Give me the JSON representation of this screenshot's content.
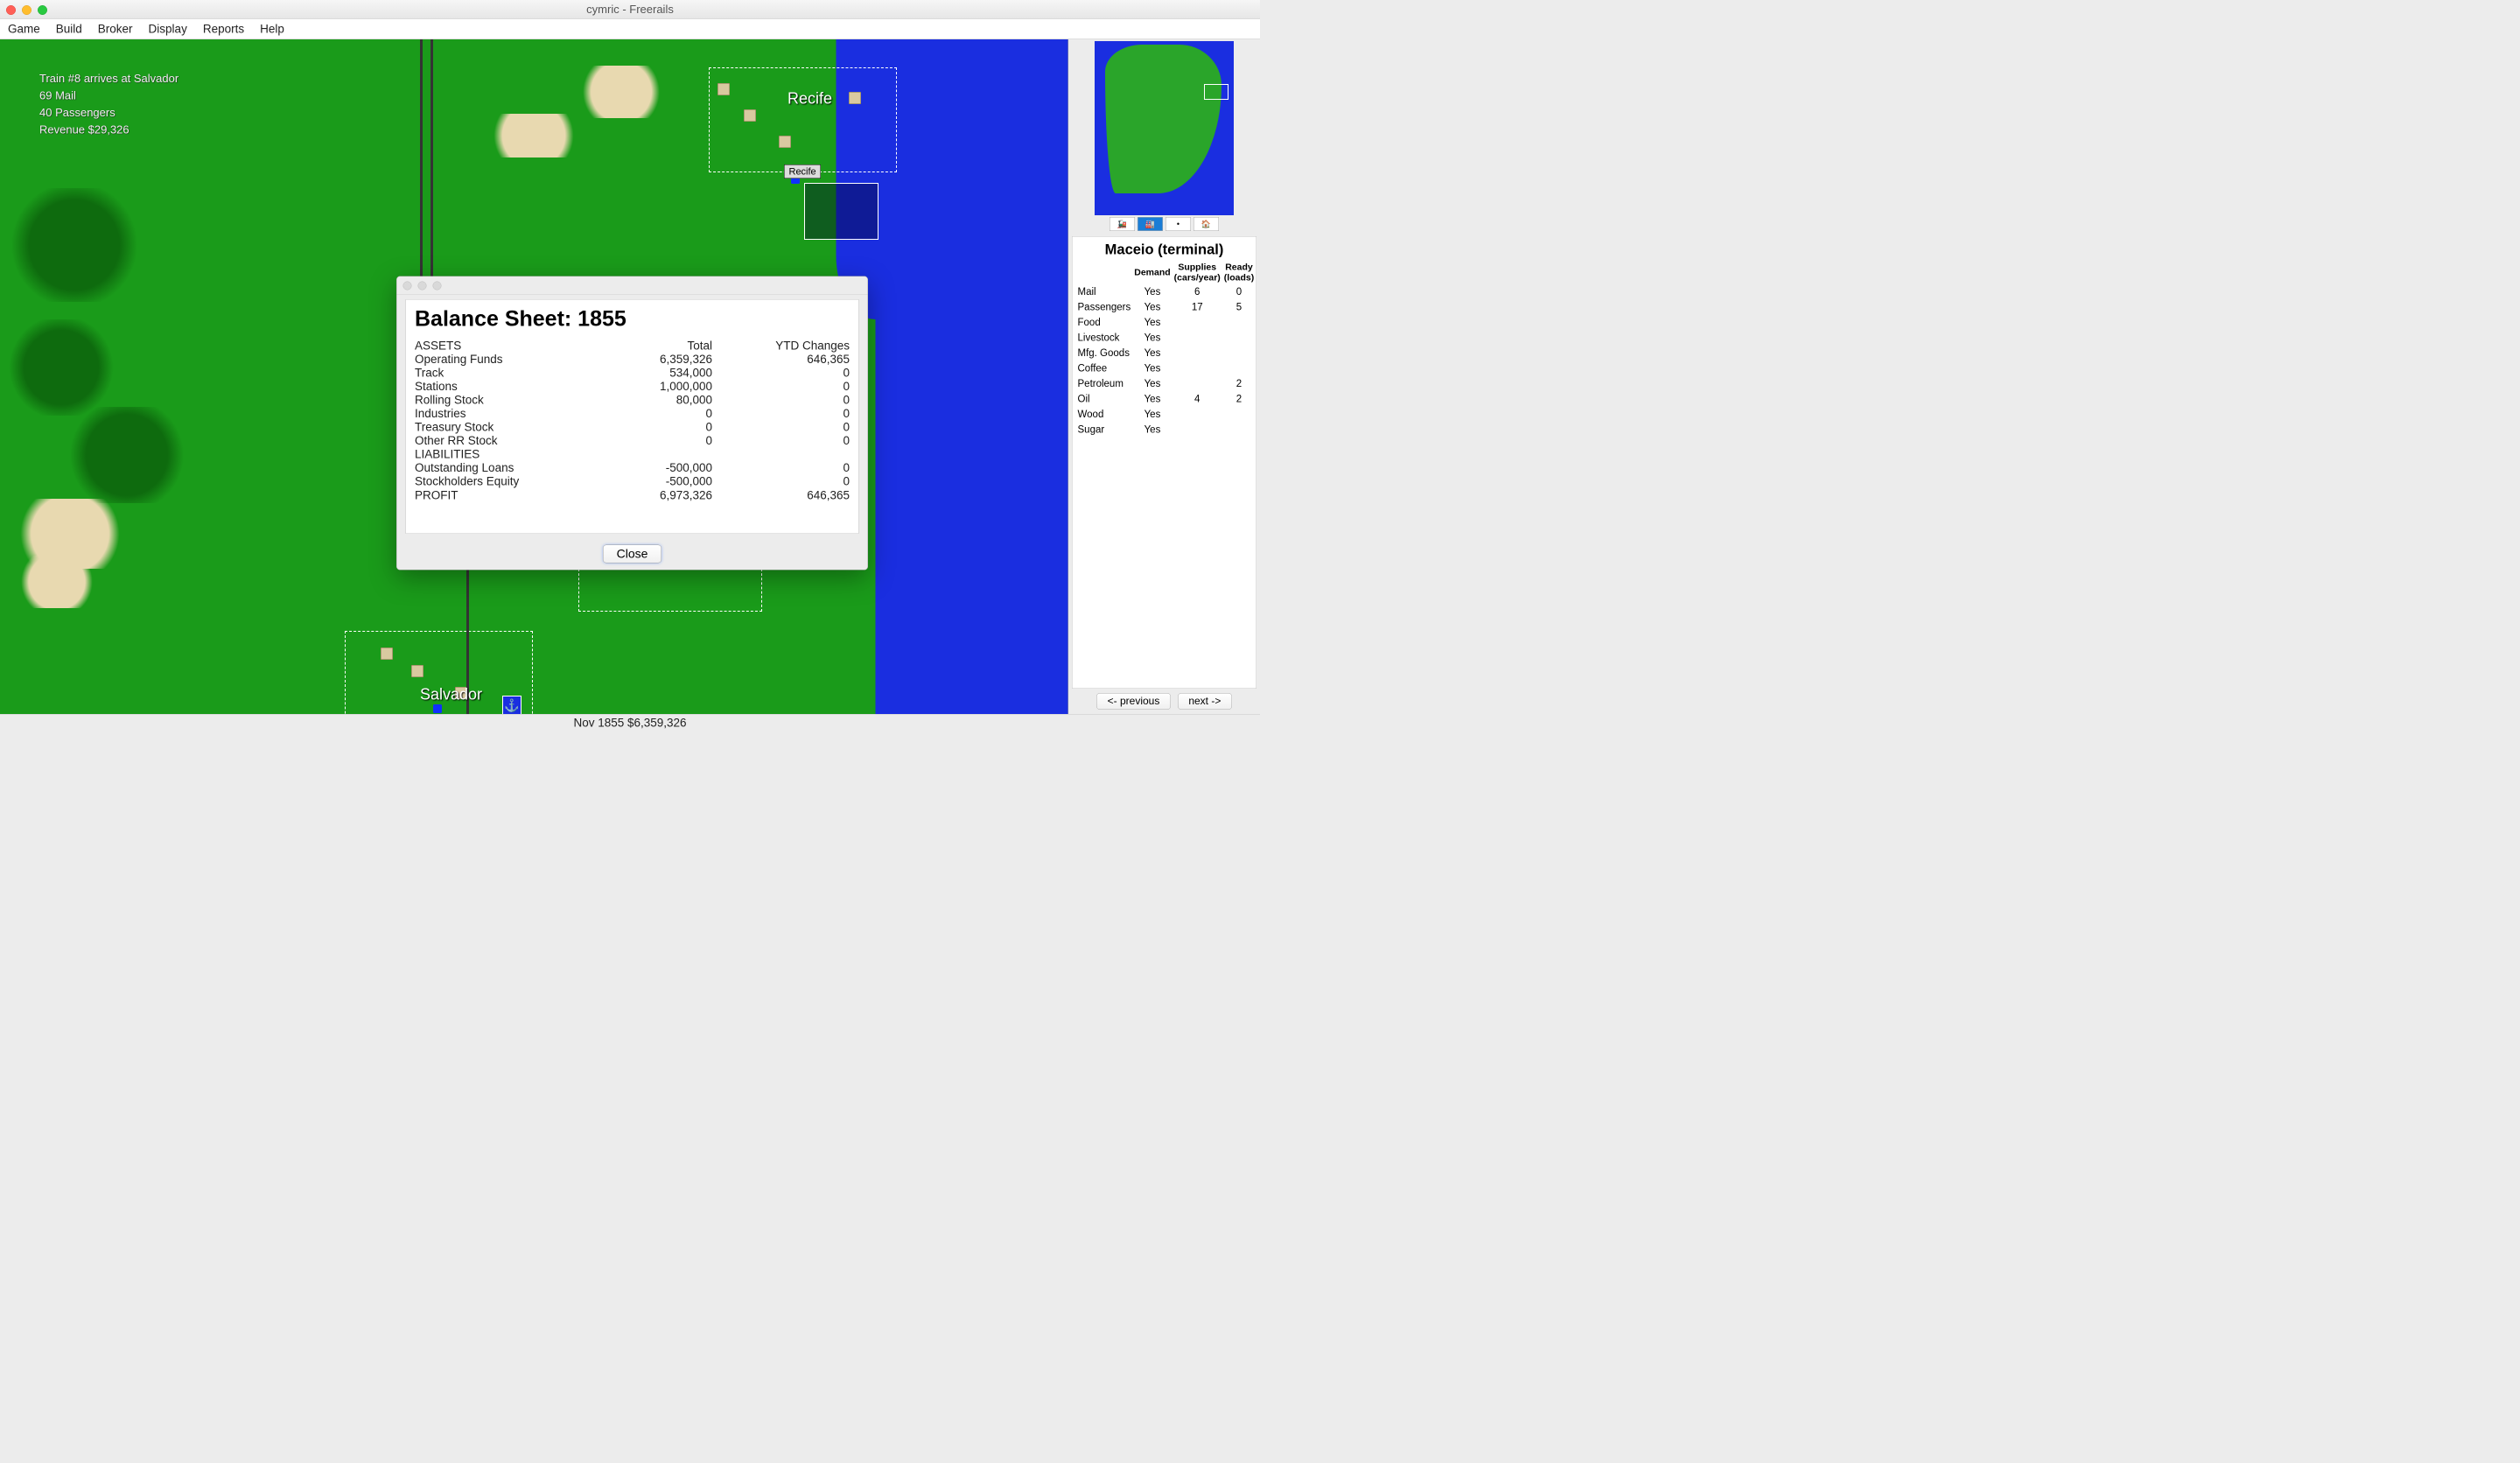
{
  "window": {
    "title": "cymric - Freerails"
  },
  "menu": {
    "game": "Game",
    "build": "Build",
    "broker": "Broker",
    "display": "Display",
    "reports": "Reports",
    "help": "Help"
  },
  "messages": {
    "line1": "Train #8 arrives at Salvador",
    "line2": "69 Mail",
    "line3": "40 Passengers",
    "line4": "Revenue $29,326"
  },
  "cities": {
    "recife": "Recife",
    "recife_marker": "Recife",
    "salvador": "Salvador"
  },
  "dialog": {
    "title": "Balance Sheet: 1855",
    "headers": {
      "assets": "ASSETS",
      "total": "Total",
      "ytd": "YTD Changes",
      "liabilities": "LIABILITIES",
      "profit": "PROFIT"
    },
    "rows": {
      "operating_funds": {
        "label": "Operating Funds",
        "total": "6,359,326",
        "ytd": "646,365"
      },
      "track": {
        "label": "Track",
        "total": "534,000",
        "ytd": "0"
      },
      "stations": {
        "label": "Stations",
        "total": "1,000,000",
        "ytd": "0"
      },
      "rolling_stock": {
        "label": "Rolling Stock",
        "total": "80,000",
        "ytd": "0"
      },
      "industries": {
        "label": "Industries",
        "total": "0",
        "ytd": "0"
      },
      "treasury_stock": {
        "label": "Treasury Stock",
        "total": "0",
        "ytd": "0"
      },
      "other_rr": {
        "label": "Other RR Stock",
        "total": "0",
        "ytd": "0"
      },
      "outstanding_loans": {
        "label": "Outstanding Loans",
        "total": "-500,000",
        "ytd": "0"
      },
      "stockholders_equity": {
        "label": "Stockholders Equity",
        "total": "-500,000",
        "ytd": "0"
      },
      "profit": {
        "total": "6,973,326",
        "ytd": "646,365"
      }
    },
    "close": "Close"
  },
  "status": {
    "text": "Nov 1855 $6,359,326"
  },
  "sidebar": {
    "station_name": "Maceio (terminal)",
    "columns": {
      "demand": "Demand",
      "supplies": "Supplies (cars/year)",
      "ready": "Ready (loads)"
    },
    "rows": [
      {
        "name": "Mail",
        "demand": "Yes",
        "supplies": "6",
        "ready": "0"
      },
      {
        "name": "Passengers",
        "demand": "Yes",
        "supplies": "17",
        "ready": "5"
      },
      {
        "name": "Food",
        "demand": "Yes",
        "supplies": "",
        "ready": ""
      },
      {
        "name": "Livestock",
        "demand": "Yes",
        "supplies": "",
        "ready": ""
      },
      {
        "name": "Mfg. Goods",
        "demand": "Yes",
        "supplies": "",
        "ready": ""
      },
      {
        "name": "Coffee",
        "demand": "Yes",
        "supplies": "",
        "ready": ""
      },
      {
        "name": "Petroleum",
        "demand": "Yes",
        "supplies": "",
        "ready": "2"
      },
      {
        "name": "Oil",
        "demand": "Yes",
        "supplies": "4",
        "ready": "2"
      },
      {
        "name": "Wood",
        "demand": "Yes",
        "supplies": "",
        "ready": ""
      },
      {
        "name": "Sugar",
        "demand": "Yes",
        "supplies": "",
        "ready": ""
      }
    ],
    "prev": "<- previous",
    "next": "next ->"
  },
  "anchor_glyph": "⚓"
}
